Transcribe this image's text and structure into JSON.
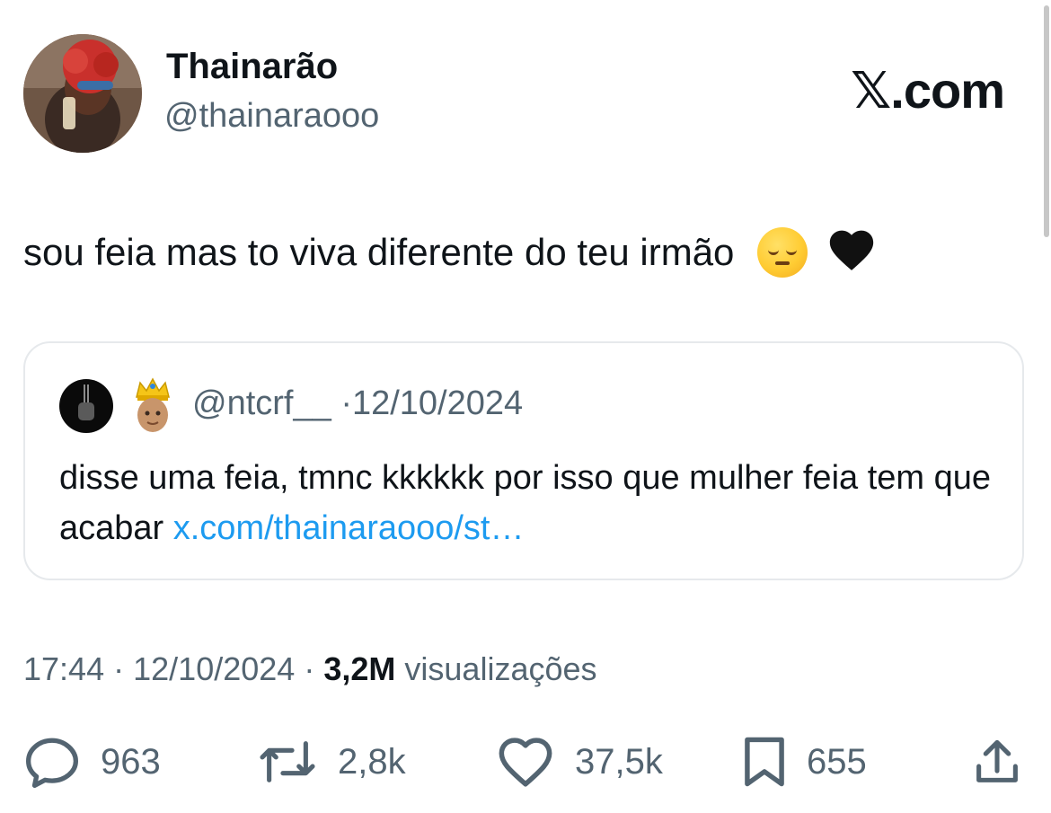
{
  "header": {
    "display_name": "Thainarão",
    "handle": "@thainaraooo",
    "brand": "𝕏.com"
  },
  "tweet": {
    "text": "sou feia mas to viva diferente do teu irmão",
    "emoji_heart": "🖤"
  },
  "quote": {
    "handle": "@ntcrf__",
    "separator": "·",
    "date": "12/10/2024",
    "text": "disse uma feia, tmnc kkkkkk por isso que mulher feia tem que acabar ",
    "link": "x.com/thainaraooo/st…"
  },
  "meta": {
    "time": "17:44",
    "separator": "·",
    "date": "12/10/2024",
    "views_count": "3,2M",
    "views_label": "visualizações"
  },
  "actions": {
    "replies": "963",
    "reposts": "2,8k",
    "likes": "37,5k",
    "bookmarks": "655"
  },
  "icons": {
    "reply": "reply-icon",
    "repost": "repost-icon",
    "like": "heart-icon",
    "bookmark": "bookmark-icon",
    "share": "share-icon"
  },
  "colors": {
    "text": "#0f1419",
    "secondary": "#536471",
    "link": "#1d9bf0",
    "border": "#e6e9ec"
  }
}
